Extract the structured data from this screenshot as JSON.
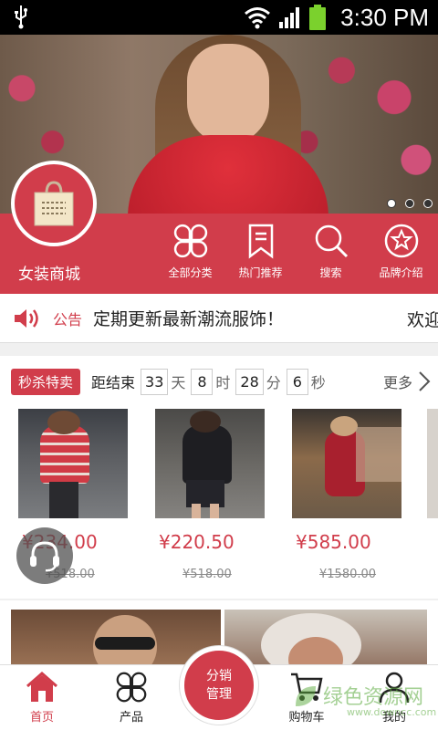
{
  "status_bar": {
    "time": "3:30 PM"
  },
  "shop": {
    "name": "女装商城"
  },
  "nav": [
    {
      "label": "全部分类",
      "icon": "four-petal-grid-icon"
    },
    {
      "label": "热门推荐",
      "icon": "bookmark-icon"
    },
    {
      "label": "搜索",
      "icon": "search-icon"
    },
    {
      "label": "品牌介绍",
      "icon": "brand-badge-icon"
    }
  ],
  "notice": {
    "label": "公告",
    "text": "定期更新最新潮流服饰！",
    "text2": "欢迎"
  },
  "flash_sale": {
    "badge": "秒杀特卖",
    "countdown_label": "距结束",
    "days": "33",
    "days_unit": "天",
    "hours": "8",
    "hours_unit": "时",
    "minutes": "28",
    "minutes_unit": "分",
    "seconds": "6",
    "seconds_unit": "秒",
    "more": "更多"
  },
  "products": [
    {
      "price": "¥234.00",
      "original_price": "¥518.00"
    },
    {
      "price": "¥220.50",
      "original_price": "¥518.00"
    },
    {
      "price": "¥585.00",
      "original_price": "¥1580.00"
    }
  ],
  "bottom_nav": {
    "home": "首页",
    "products": "产品",
    "center_line1": "分销",
    "center_line2": "管理",
    "cart": "购物车",
    "mine": "我的"
  },
  "watermark": {
    "text": "绿色资源网",
    "sub": "www.downcc.com"
  },
  "colors": {
    "accent": "#d13d4b"
  }
}
